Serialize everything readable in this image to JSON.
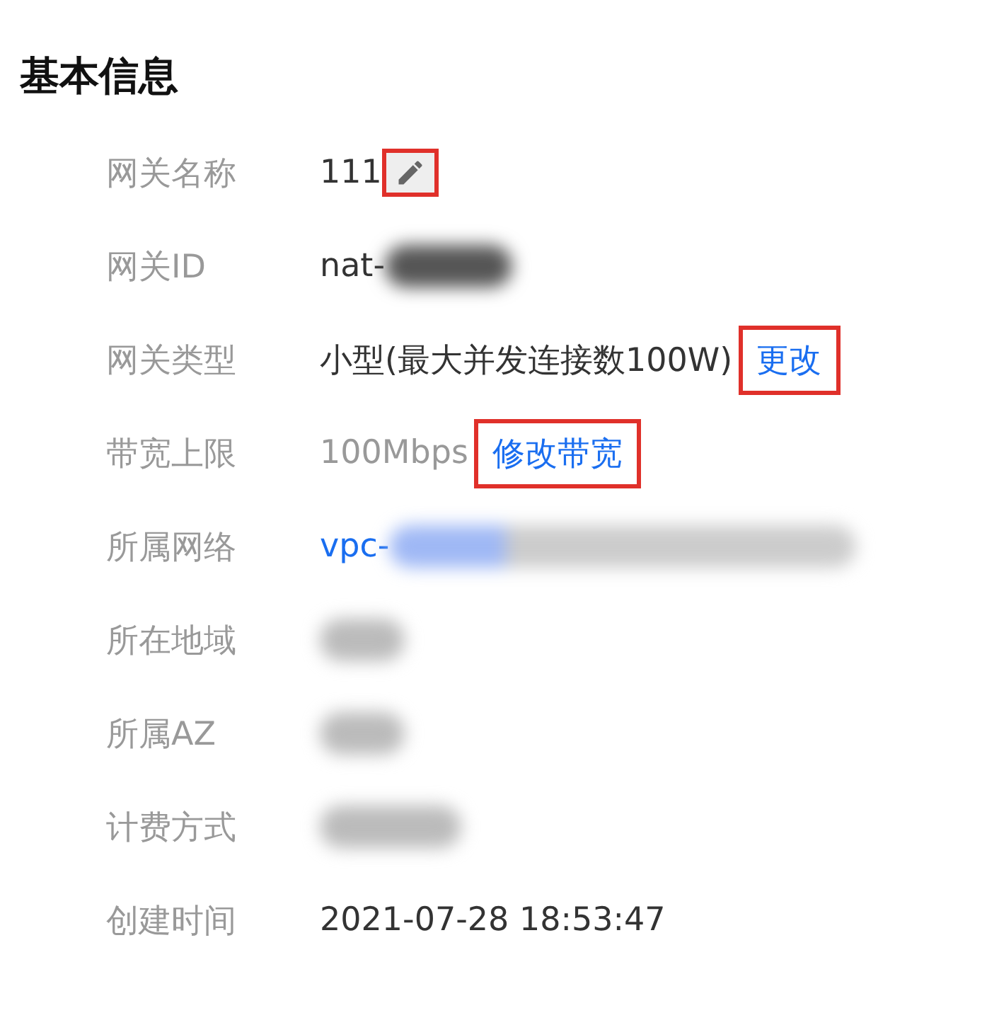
{
  "title": "基本信息",
  "rows": [
    {
      "label": "网关名称",
      "value": "111",
      "kind": "text",
      "edit": {
        "highlighted": true
      }
    },
    {
      "label": "网关ID",
      "value": "nat-",
      "kind": "text",
      "redacted": true
    },
    {
      "label": "网关类型",
      "value": "小型(最大并发连接数100W)",
      "kind": "text",
      "action": {
        "label": "更改",
        "highlighted": true
      }
    },
    {
      "label": "带宽上限",
      "value": "100Mbps",
      "kind": "muted",
      "action": {
        "label": "修改带宽",
        "highlighted": true
      }
    },
    {
      "label": "所属网络",
      "value": "vpc-",
      "kind": "link",
      "redacted": true
    },
    {
      "label": "所在地域",
      "kind": "text",
      "redacted": true
    },
    {
      "label": "所属AZ",
      "kind": "text",
      "redacted": true
    },
    {
      "label": "计费方式",
      "kind": "text",
      "redacted": true
    },
    {
      "label": "创建时间",
      "value": "2021-07-28 18:53:47",
      "kind": "text"
    }
  ]
}
